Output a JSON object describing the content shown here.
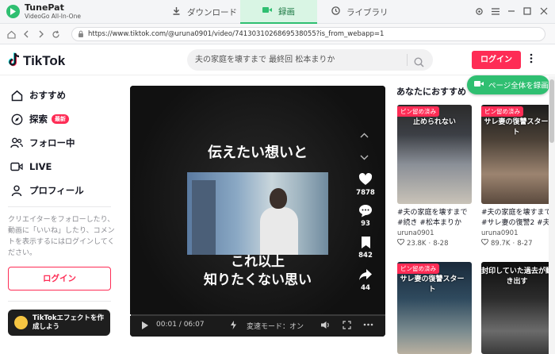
{
  "app": {
    "name": "TunePat",
    "subtitle": "VideoGo All-In-One",
    "brand_color": "#2fbf71"
  },
  "tabs": [
    {
      "label": "ダウンロード",
      "active": false
    },
    {
      "label": "録画",
      "active": true
    },
    {
      "label": "ライブラリ",
      "active": false
    }
  ],
  "window_controls": [
    "settings-icon",
    "menu-icon",
    "minimize-icon",
    "maximize-icon",
    "close-icon"
  ],
  "address": {
    "url": "https://www.tiktok.com/@uruna0901/video/7413031026869538055?is_from_webapp=1"
  },
  "tiktok": {
    "logo": "TikTok",
    "search_placeholder": "夫の家庭を壊すまで 最終回 松本まりか",
    "login_label": "ログイン",
    "accent": "#fe2c55"
  },
  "sidebar": {
    "items": [
      {
        "label": "おすすめ",
        "icon": "home-icon"
      },
      {
        "label": "探索",
        "icon": "compass-icon",
        "badge": "最新"
      },
      {
        "label": "フォロー中",
        "icon": "users-icon"
      },
      {
        "label": "LIVE",
        "icon": "live-icon"
      },
      {
        "label": "プロフィール",
        "icon": "person-icon"
      }
    ],
    "prompt_text": "クリエイターをフォローしたり、動画に「いいね」したり、コメントを表示するにはログインしてください。",
    "login_label": "ログイン",
    "effect_label": "TikTokエフェクトを作成しよう"
  },
  "player": {
    "caption_top": "伝えたい想いと",
    "caption_bottom_1": "これ以上",
    "caption_bottom_2": "知りたくない思い",
    "likes": "7878",
    "comments": "93",
    "saves": "842",
    "shares": "44",
    "time": "00:01 / 06:07",
    "speed_label": "変速モード：オン",
    "progress": 0.003
  },
  "record_button": {
    "label": "ページ全体を録画"
  },
  "recommendations": {
    "title": "あなたにおすすめ",
    "cards": [
      {
        "pinned": "ピン留め済み",
        "caption": "止められない",
        "desc": "#夫の家庭を壊すまで #続き #松本まりか",
        "author": "uruna0901",
        "likes": "23.8K",
        "date": "8-28"
      },
      {
        "pinned": "ピン留め済み",
        "caption": "サレ妻の復讐スタート",
        "desc": "#夫の家庭を壊すまで #サレ妻の復讐2 #夫",
        "author": "uruna0901",
        "likes": "89.7K",
        "date": "8-27"
      },
      {
        "pinned": "ピン留め済み",
        "caption": "サレ妻の復讐スタート",
        "desc": "",
        "author": "",
        "likes": "",
        "date": ""
      },
      {
        "pinned": "",
        "caption": "封印していた過去が動き出す",
        "desc": "",
        "author": "",
        "likes": "",
        "date": ""
      }
    ]
  }
}
